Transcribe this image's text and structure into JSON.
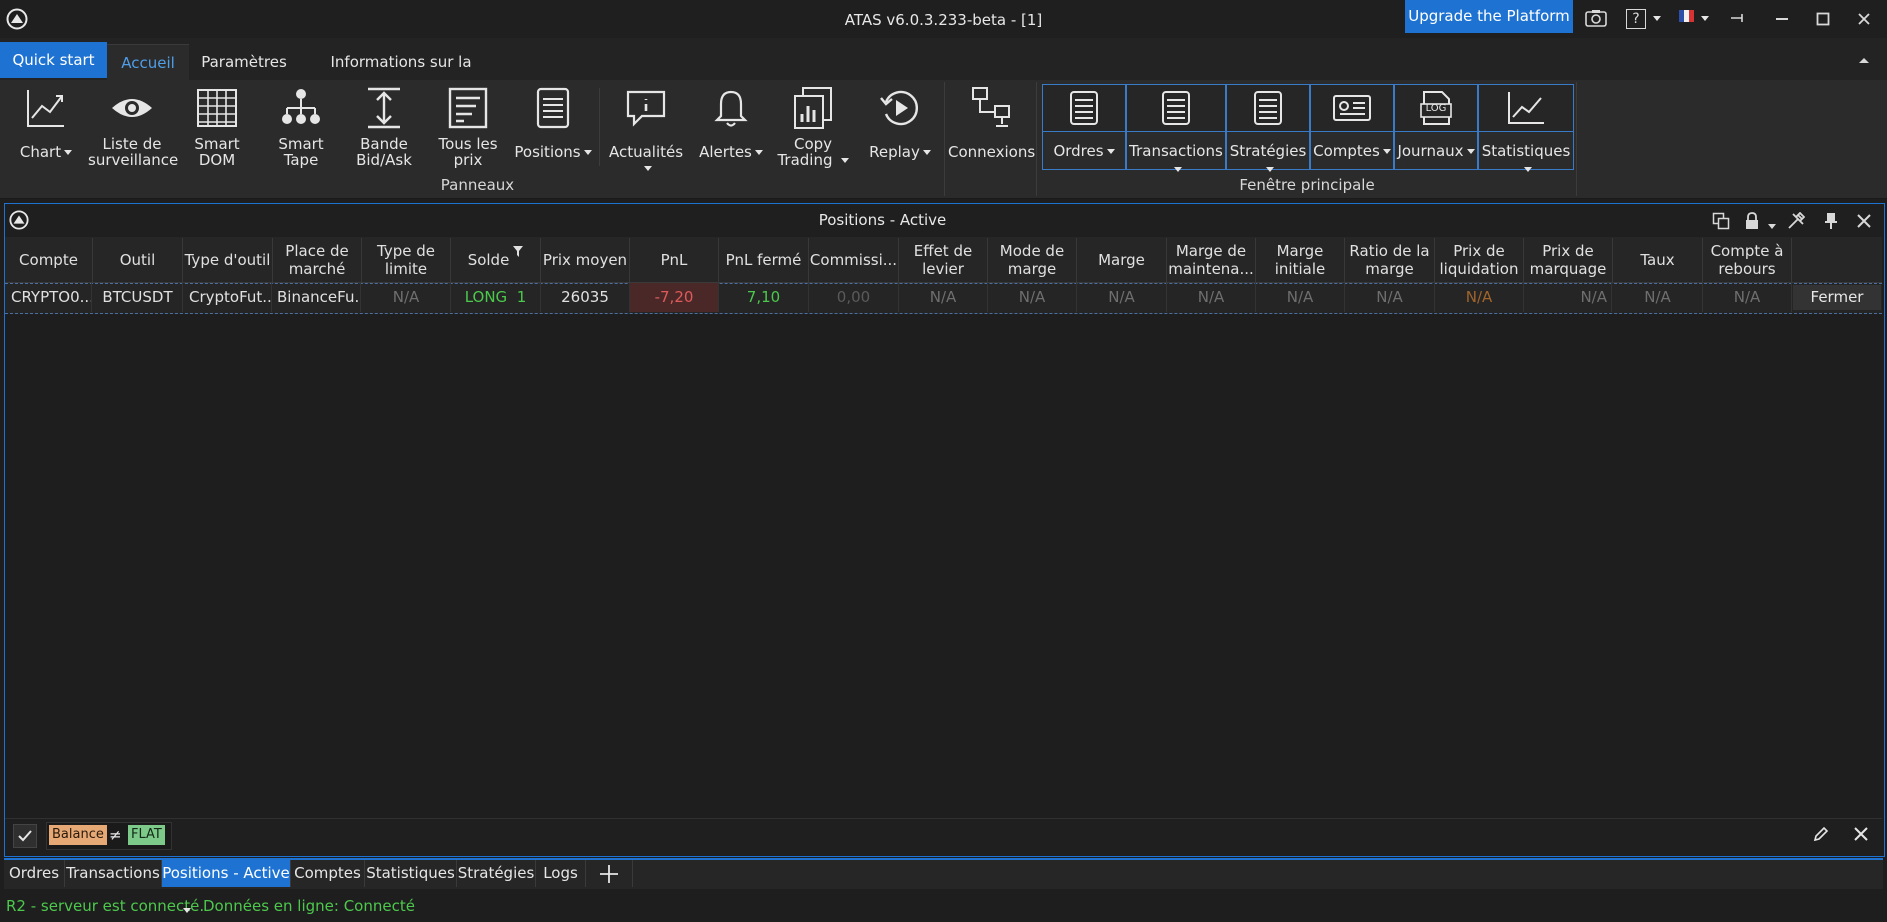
{
  "window": {
    "title": "ATAS v6.0.3.233-beta - [1]",
    "upgrade_label": "Upgrade the Platform",
    "help_label": "?"
  },
  "ribbon_tabs": {
    "quick_start": "Quick start",
    "home": "Accueil",
    "settings": "Paramètres",
    "license": "Informations sur la licence"
  },
  "panels_group": {
    "label": "Panneaux",
    "chart": "Chart",
    "watchlist_1": "Liste de",
    "watchlist_2": "surveillance",
    "smart_dom_1": "Smart",
    "smart_dom_2": "DOM",
    "smart_tape_1": "Smart",
    "smart_tape_2": "Tape",
    "bidask_1": "Bande",
    "bidask_2": "Bid/Ask",
    "all_prices_1": "Tous les",
    "all_prices_2": "prix",
    "positions": "Positions",
    "news": "Actualités",
    "alerts": "Alertes",
    "copy_1": "Copy",
    "copy_2": "Trading",
    "replay": "Replay"
  },
  "connections": {
    "label": "Connexions"
  },
  "main_window_group": {
    "label": "Fenêtre principale",
    "orders": "Ordres",
    "transactions": "Transactions",
    "strategies": "Stratégies",
    "accounts": "Comptes",
    "journals": "Journaux",
    "journals_icon_text": "LOG",
    "statistics": "Statistiques"
  },
  "panel": {
    "title": "Positions - Active",
    "columns": [
      "Compte",
      "Outil",
      "Type d'outil",
      "Place de marché",
      "Type de limite",
      "Solde",
      "Prix moyen",
      "PnL",
      "PnL fermé",
      "Commissi...",
      "Effet de levier",
      "Mode de marge",
      "Marge",
      "Marge de maintena...",
      "Marge initiale",
      "Ratio de la marge",
      "Prix de liquidation",
      "Prix de marquage",
      "Taux",
      "Compte à rebours"
    ],
    "row": {
      "account": "CRYPTO0...",
      "tool": "BTCUSDT",
      "tool_type": "CryptoFut...",
      "market": "BinanceFu...",
      "limit_type": "N/A",
      "balance_side": "LONG",
      "balance_qty": "1",
      "avg_price": "26035",
      "pnl": "-7,20",
      "closed_pnl": "7,10",
      "commission": "0,00",
      "leverage": "N/A",
      "margin_mode": "N/A",
      "margin": "N/A",
      "maintenance_margin": "N/A",
      "initial_margin": "N/A",
      "margin_ratio": "N/A",
      "liquidation_price": "N/A",
      "mark_price": "N/A",
      "rate": "N/A",
      "countdown": "N/A",
      "close_label": "Fermer"
    },
    "filter": {
      "field": "Balance",
      "operator": "≠",
      "value": "FLAT"
    }
  },
  "bottom_tabs": [
    "Ordres",
    "Transactions",
    "Positions - Active",
    "Comptes",
    "Statistiques",
    "Stratégies",
    "Logs"
  ],
  "status": {
    "server": "R2 - serveur est connecté.",
    "data": "Données en ligne: Connecté"
  },
  "colors": {
    "accent": "#1e73d2",
    "positive": "#4cc94c",
    "negative": "#e05a5a",
    "liquidation": "#a0642a"
  }
}
